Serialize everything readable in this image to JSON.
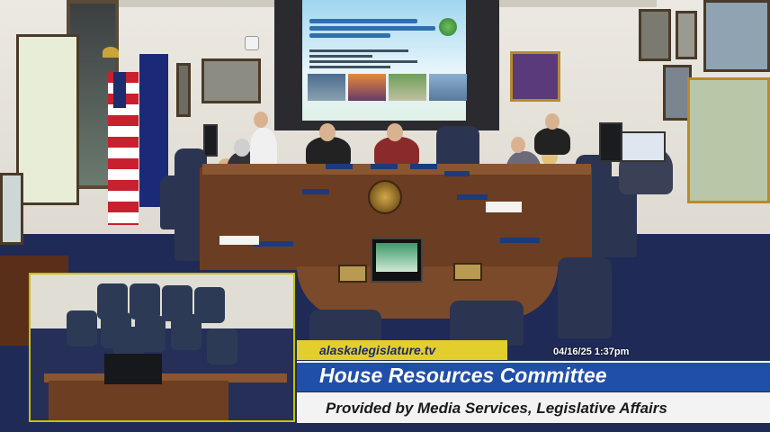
{
  "overlay": {
    "url": "alaskalegislature.tv",
    "timestamp": "04/16/25 1:37pm",
    "committee_title": "House Resources Committee",
    "provider_line": "Provided by Media Services, Legislative Affairs"
  },
  "colors": {
    "url_banner": "#e2cf2e",
    "title_banner": "#1f4fa8",
    "subtitle_banner": "#f3f3f3",
    "pip_border": "#c7c000",
    "carpet": "#1f2a57"
  },
  "scene": {
    "description_icons": [
      "alaska-flag",
      "us-flag",
      "state-seal",
      "projection-screen",
      "laptop",
      "speaker"
    ]
  }
}
